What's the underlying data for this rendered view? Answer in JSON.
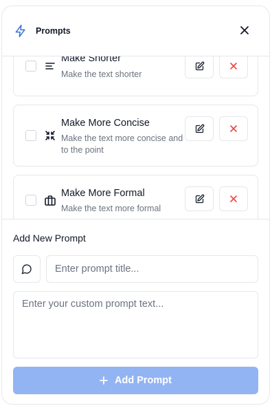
{
  "header": {
    "title": "Prompts",
    "logo_icon": "lightning-icon",
    "close_icon": "close-icon"
  },
  "prompts": [
    {
      "name": "Make Shorter",
      "description": "Make the text shorter",
      "icon": "align-left-icon",
      "checked": false
    },
    {
      "name": "Make More Concise",
      "description": "Make the text more concise and to the point",
      "icon": "minimize-icon",
      "checked": false
    },
    {
      "name": "Make More Formal",
      "description": "Make the text more formal",
      "icon": "briefcase-icon",
      "checked": false
    }
  ],
  "add_section": {
    "heading": "Add New Prompt",
    "icon_picker": "message-circle-icon",
    "title_placeholder": "Enter prompt title...",
    "text_placeholder": "Enter your custom prompt text...",
    "button_label": "Add Prompt"
  },
  "colors": {
    "accent": "#3b6fd4",
    "delete": "#ef4444",
    "button_disabled": "#93b4f2"
  }
}
